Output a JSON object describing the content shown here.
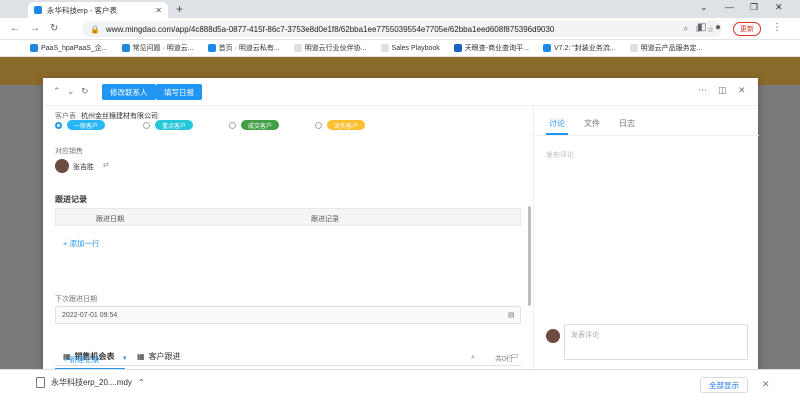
{
  "browser": {
    "tab_title": "永华科技erp - 客户表",
    "url": "www.mingdao.com/app/4c888d5a-0877-415f-86c7-3753e8d0e1f8/62bba1ee7755039554e7705e/62bba1eed608f875396d9030",
    "update_label": "更新",
    "bookmarks": [
      "PaaS_hpaPaaS_企...",
      "常见问题 · 明道云...",
      "首页 · 明道云私有...",
      "明道云行业伙伴协...",
      "Sales Playbook",
      "天眼查-商业查询平...",
      "V7.2: \"封装业务流...",
      "明道云产品服务定..."
    ]
  },
  "modal": {
    "btn_edit_contact": "修改联系人",
    "btn_write_log": "填写日报",
    "customer_table_label": "客户表",
    "customer_name": "杭州金丝猴建材有限公司",
    "customer_types": [
      {
        "label": "一般客户",
        "color": "#29b6f6"
      },
      {
        "label": "重点客户",
        "color": "#26c6da"
      },
      {
        "label": "成交客户",
        "color": "#43a047"
      },
      {
        "label": "流失客户",
        "color": "#fbc02d"
      }
    ],
    "sales_label": "对应销售",
    "sales_person": "张吉胜",
    "followup_title": "跟进记录",
    "col_date": "跟进日期",
    "col_record": "跟进记录",
    "add_row": "+ 添加一行",
    "next_followup_label": "下次跟进日期",
    "next_followup_value": "2022-07-01 09:54",
    "tab_opportunity": "销售机会表",
    "tab_customer_followup": "客户跟进",
    "new_record": "+ 新建记录",
    "total": "共0行"
  },
  "sidebar": {
    "tab_discussion": "讨论",
    "tab_files": "文件",
    "tab_log": "日志",
    "post_comment_hint": "发布评论",
    "comment_placeholder": "发表评论"
  },
  "download": {
    "filename": "永华科技erp_20....mdy",
    "show_all": "全部显示"
  }
}
